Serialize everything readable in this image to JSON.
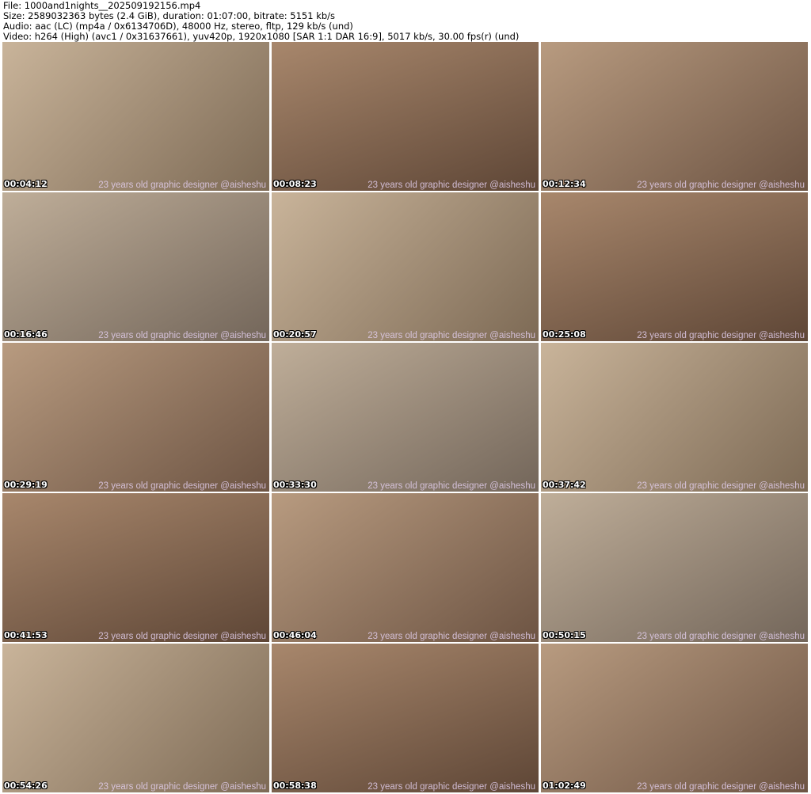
{
  "header": {
    "file": "File: 1000and1nights__202509192156.mp4",
    "size": "Size: 2589032363 bytes (2.4 GiB), duration: 01:07:00, bitrate: 5151 kb/s",
    "audio": "Audio: aac (LC) (mp4a / 0x6134706D), 48000 Hz, stereo, fltp, 129 kb/s (und)",
    "video": "Video: h264 (High) (avc1 / 0x31637661), yuv420p, 1920x1080 [SAR 1:1 DAR 16:9], 5017 kb/s, 30.00 fps(r) (und)"
  },
  "watermark": "23 years old graphic designer @aisheshu",
  "thumbnails": [
    {
      "time": "00:04:12"
    },
    {
      "time": "00:08:23"
    },
    {
      "time": "00:12:34"
    },
    {
      "time": "00:16:46"
    },
    {
      "time": "00:20:57"
    },
    {
      "time": "00:25:08"
    },
    {
      "time": "00:29:19"
    },
    {
      "time": "00:33:30"
    },
    {
      "time": "00:37:42"
    },
    {
      "time": "00:41:53"
    },
    {
      "time": "00:46:04"
    },
    {
      "time": "00:50:15"
    },
    {
      "time": "00:54:26"
    },
    {
      "time": "00:58:38"
    },
    {
      "time": "01:02:49"
    }
  ]
}
